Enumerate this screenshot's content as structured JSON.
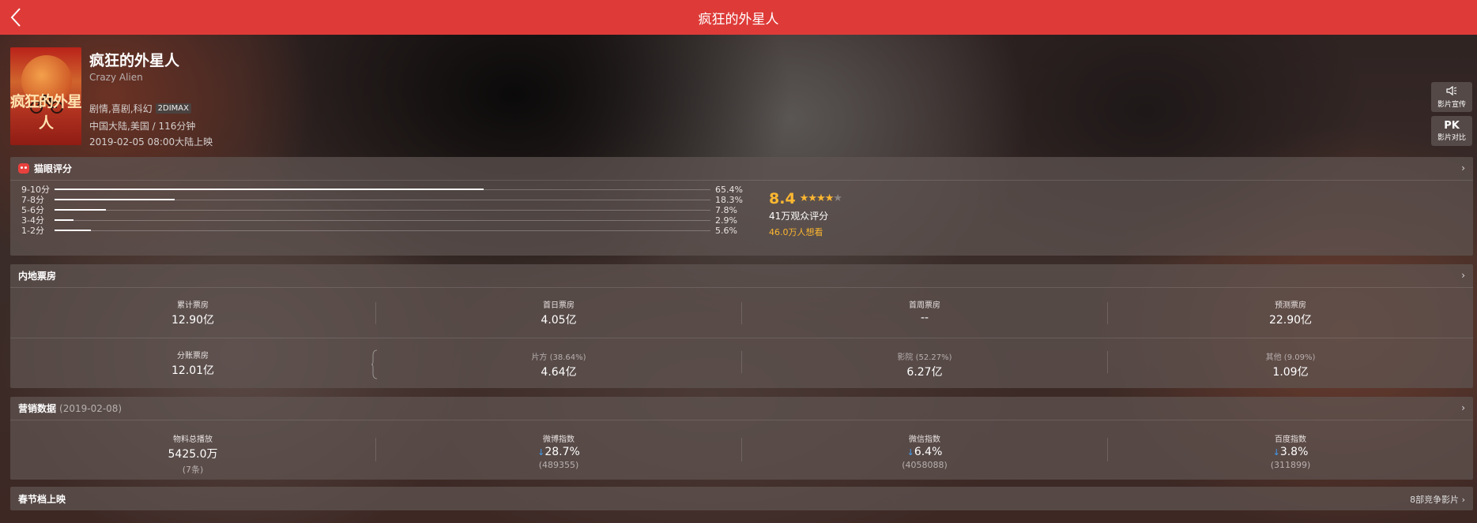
{
  "header": {
    "title": "疯狂的外星人",
    "back_icon": "back-chevron-icon",
    "bg_color": "#de3b38"
  },
  "movie": {
    "poster_text": "疯狂的外星人",
    "title": "疯狂的外星人",
    "english_name": "Crazy Alien",
    "genres": "剧情,喜剧,科幻",
    "format_tag": "2DIMAX",
    "region_duration": "中国大陆,美国 / 116分钟",
    "release": "2019-02-05 08:00大陆上映"
  },
  "side_buttons": [
    {
      "icon": "megaphone-icon",
      "label": "影片宣传"
    },
    {
      "icon_text": "PK",
      "label": "影片对比"
    }
  ],
  "rating": {
    "title": "猫眼评分",
    "distribution": [
      {
        "label": "9-10分",
        "value": 65.4,
        "pct": "65.4%"
      },
      {
        "label": "7-8分",
        "value": 18.3,
        "pct": "18.3%"
      },
      {
        "label": "5-6分",
        "value": 7.8,
        "pct": "7.8%"
      },
      {
        "label": "3-4分",
        "value": 2.9,
        "pct": "2.9%"
      },
      {
        "label": "1-2分",
        "value": 5.6,
        "pct": "5.6%"
      }
    ],
    "score": "8.4",
    "stars_filled": 4,
    "stars_total": 5,
    "count": "41万观众评分",
    "want": "46.0万人想看",
    "accent": "#fdb731"
  },
  "boxoffice": {
    "title": "内地票房",
    "row1": [
      {
        "label": "累计票房",
        "value": "12.90亿"
      },
      {
        "label": "首日票房",
        "value": "4.05亿"
      },
      {
        "label": "首周票房",
        "value": "--"
      },
      {
        "label": "预测票房",
        "value": "22.90亿"
      }
    ],
    "row2": [
      {
        "label": "分账票房",
        "value": "12.01亿"
      },
      {
        "label": "片方 (38.64%)",
        "value": "4.64亿"
      },
      {
        "label": "影院 (52.27%)",
        "value": "6.27亿"
      },
      {
        "label": "其他 (9.09%)",
        "value": "1.09亿"
      }
    ]
  },
  "marketing": {
    "title": "营销数据",
    "date": "(2019-02-08)",
    "items": [
      {
        "label": "物料总播放",
        "value": "5425.0万",
        "sub": "(7条)",
        "arrow": ""
      },
      {
        "label": "微博指数",
        "value": "28.7%",
        "sub": "(489355)",
        "arrow": "↓"
      },
      {
        "label": "微信指数",
        "value": "6.4%",
        "sub": "(4058088)",
        "arrow": "↓"
      },
      {
        "label": "百度指数",
        "value": "3.8%",
        "sub": "(311899)",
        "arrow": "↓"
      }
    ],
    "arrow_color": "#3f9bf0"
  },
  "festival": {
    "title": "春节档上映",
    "right_link": "8部竞争影片"
  }
}
